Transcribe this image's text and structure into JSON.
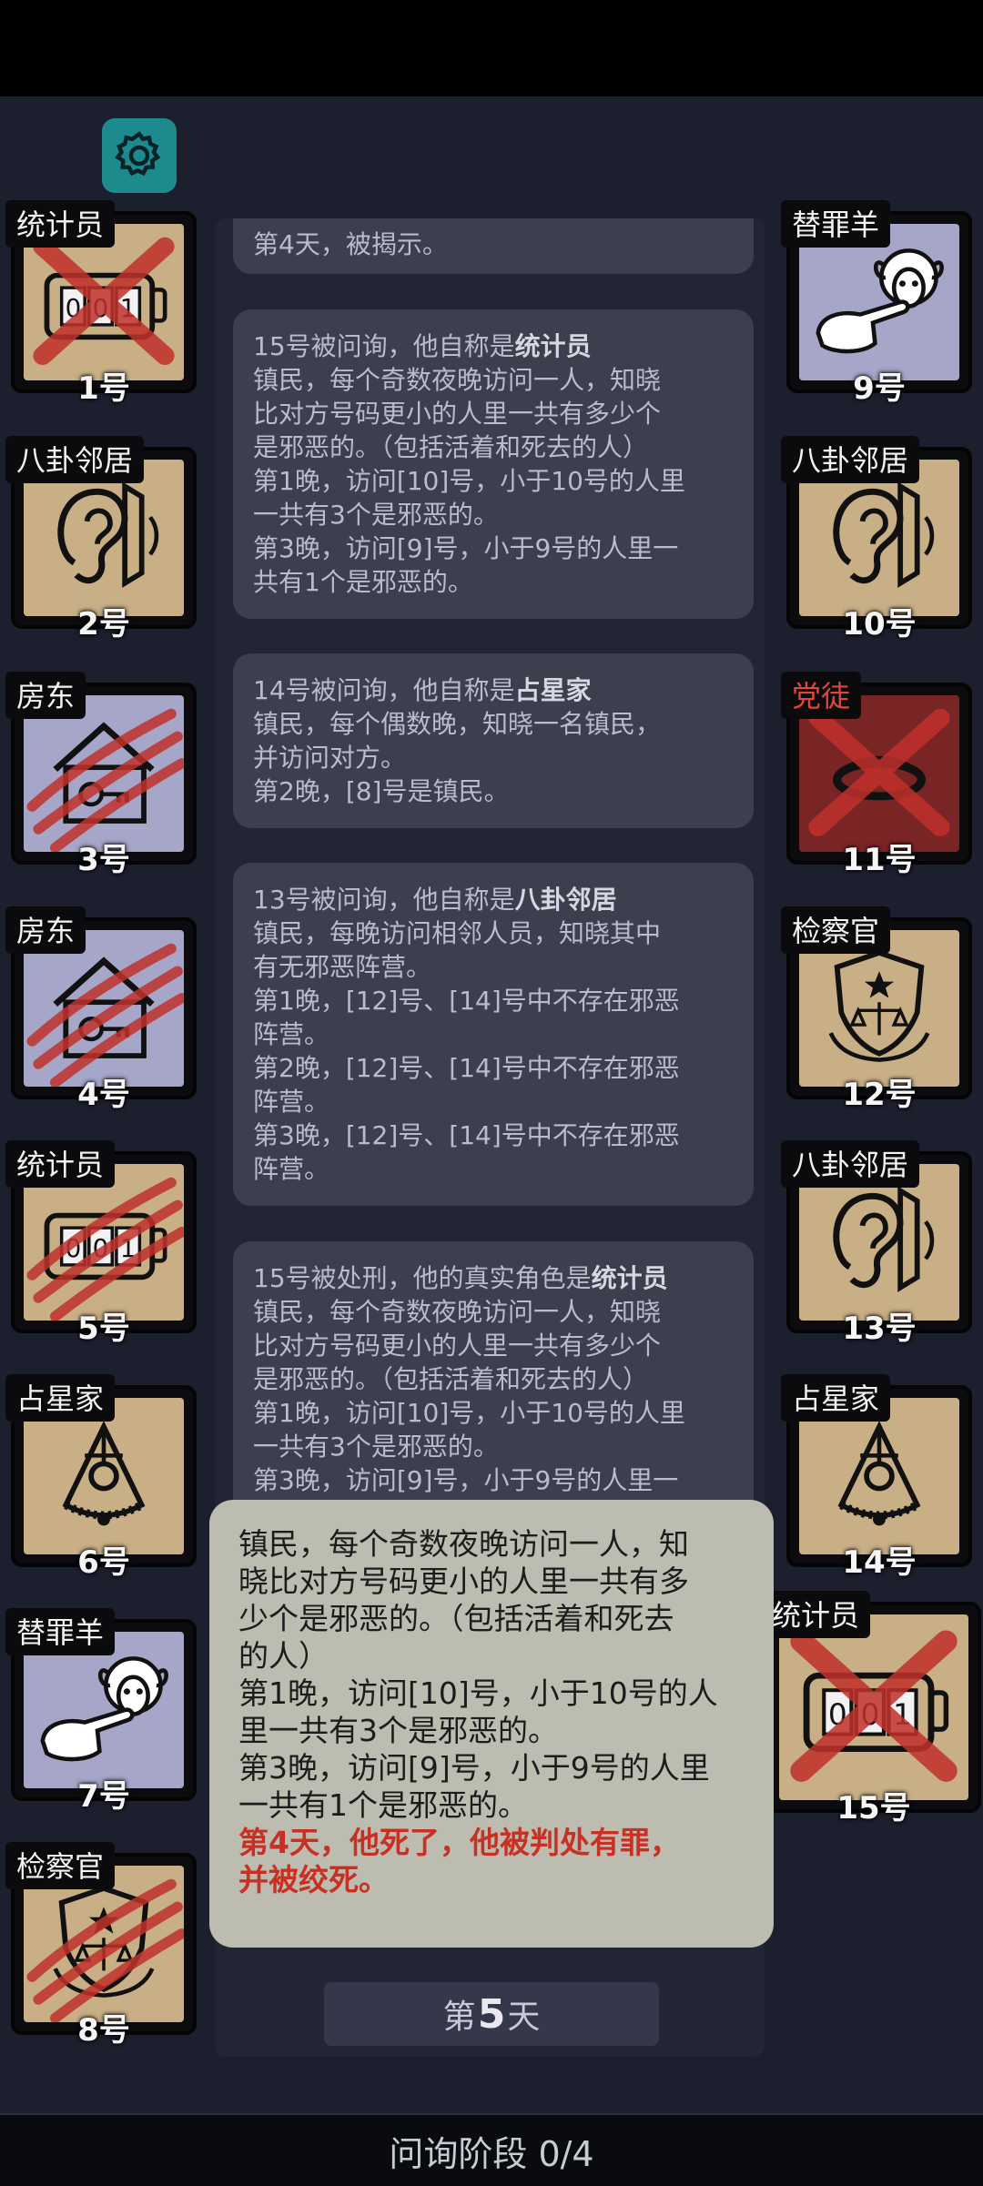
{
  "header": {
    "settings_icon": "gear-icon"
  },
  "players": [
    {
      "num": "1号",
      "role": "统计员",
      "evil": false,
      "bg": "tan",
      "icon": "counter-icon",
      "status": "executed"
    },
    {
      "num": "2号",
      "role": "八卦邻居",
      "evil": false,
      "bg": "tan",
      "icon": "ear-icon",
      "status": "alive"
    },
    {
      "num": "3号",
      "role": "房东",
      "evil": false,
      "bg": "lav",
      "icon": "house-key-icon",
      "status": "clawed"
    },
    {
      "num": "4号",
      "role": "房东",
      "evil": false,
      "bg": "lav",
      "icon": "house-key-icon",
      "status": "clawed"
    },
    {
      "num": "5号",
      "role": "统计员",
      "evil": false,
      "bg": "tan",
      "icon": "counter-icon",
      "status": "clawed"
    },
    {
      "num": "6号",
      "role": "占星家",
      "evil": false,
      "bg": "tan",
      "icon": "sextant-icon",
      "status": "alive"
    },
    {
      "num": "7号",
      "role": "替罪羊",
      "evil": false,
      "bg": "lav",
      "icon": "sheep-icon",
      "status": "alive"
    },
    {
      "num": "8号",
      "role": "检察官",
      "evil": false,
      "bg": "tan",
      "icon": "justice-badge-icon",
      "status": "clawed"
    },
    {
      "num": "9号",
      "role": "替罪羊",
      "evil": false,
      "bg": "lav",
      "icon": "sheep-icon",
      "status": "alive"
    },
    {
      "num": "10号",
      "role": "八卦邻居",
      "evil": false,
      "bg": "tan",
      "icon": "ear-icon",
      "status": "alive"
    },
    {
      "num": "11号",
      "role": "党徒",
      "evil": true,
      "bg": "red",
      "icon": "ring-icon",
      "status": "executed"
    },
    {
      "num": "12号",
      "role": "检察官",
      "evil": false,
      "bg": "tan",
      "icon": "justice-badge-icon",
      "status": "alive"
    },
    {
      "num": "13号",
      "role": "八卦邻居",
      "evil": false,
      "bg": "tan",
      "icon": "ear-icon",
      "status": "alive"
    },
    {
      "num": "14号",
      "role": "占星家",
      "evil": false,
      "bg": "tan",
      "icon": "sextant-icon",
      "status": "alive"
    },
    {
      "num": "15号",
      "role": "统计员",
      "evil": false,
      "bg": "tan",
      "icon": "counter-icon",
      "status": "executed"
    }
  ],
  "log": [
    {
      "lines": [
        "第4天，被揭示。"
      ]
    },
    {
      "prefix": "15号被问询，他自称是",
      "bold": "统计员",
      "lines": [
        "镇民，每个奇数夜晚访问一人，知晓",
        "比对方号码更小的人里一共有多少个",
        "是邪恶的。（包括活着和死去的人）",
        "第1晚，访问[10]号，小于10号的人里",
        "一共有3个是邪恶的。",
        "第3晚，访问[9]号，小于9号的人里一",
        "共有1个是邪恶的。"
      ]
    },
    {
      "prefix": "14号被问询，他自称是",
      "bold": "占星家",
      "lines": [
        "镇民，每个偶数晚，知晓一名镇民，",
        "并访问对方。",
        "第2晚，[8]号是镇民。"
      ]
    },
    {
      "prefix": "13号被问询，他自称是",
      "bold": "八卦邻居",
      "lines": [
        "镇民，每晚访问相邻人员，知晓其中",
        "有无邪恶阵营。",
        "第1晚，[12]号、[14]号中不存在邪恶",
        "阵营。",
        "第2晚，[12]号、[14]号中不存在邪恶",
        "阵营。",
        "第3晚，[12]号、[14]号中不存在邪恶",
        "阵营。"
      ]
    },
    {
      "prefix": "15号被处刑，他的真实角色是",
      "bold": "统计员",
      "lines": [
        "镇民，每个奇数夜晚访问一人，知晓",
        "比对方号码更小的人里一共有多少个",
        "是邪恶的。（包括活着和死去的人）",
        "第1晚，访问[10]号，小于10号的人里",
        "一共有3个是邪恶的。",
        "第3晚，访问[9]号，小于9号的人里一"
      ]
    }
  ],
  "tooltip": {
    "lines": [
      "镇民，每个奇数夜晚访问一人，知",
      "晓比对方号码更小的人里一共有多",
      "少个是邪恶的。（包括活着和死去",
      "的人）",
      "第1晚，访问[10]号，小于10号的人",
      "里一共有3个是邪恶的。",
      "第3晚，访问[9]号，小于9号的人里",
      "一共有1个是邪恶的。"
    ],
    "red_lines": [
      "第4天，他死了，他被判处有罪，",
      "并被绞死。"
    ]
  },
  "day": {
    "prefix": "第",
    "number": "5",
    "suffix": "天"
  },
  "phase": "问询阶段 0/4",
  "colors": {
    "tan": "#c8af86",
    "lavender": "#a5a6c8",
    "evil_red": "#e2453a",
    "gear_teal": "#1d8a8e"
  }
}
